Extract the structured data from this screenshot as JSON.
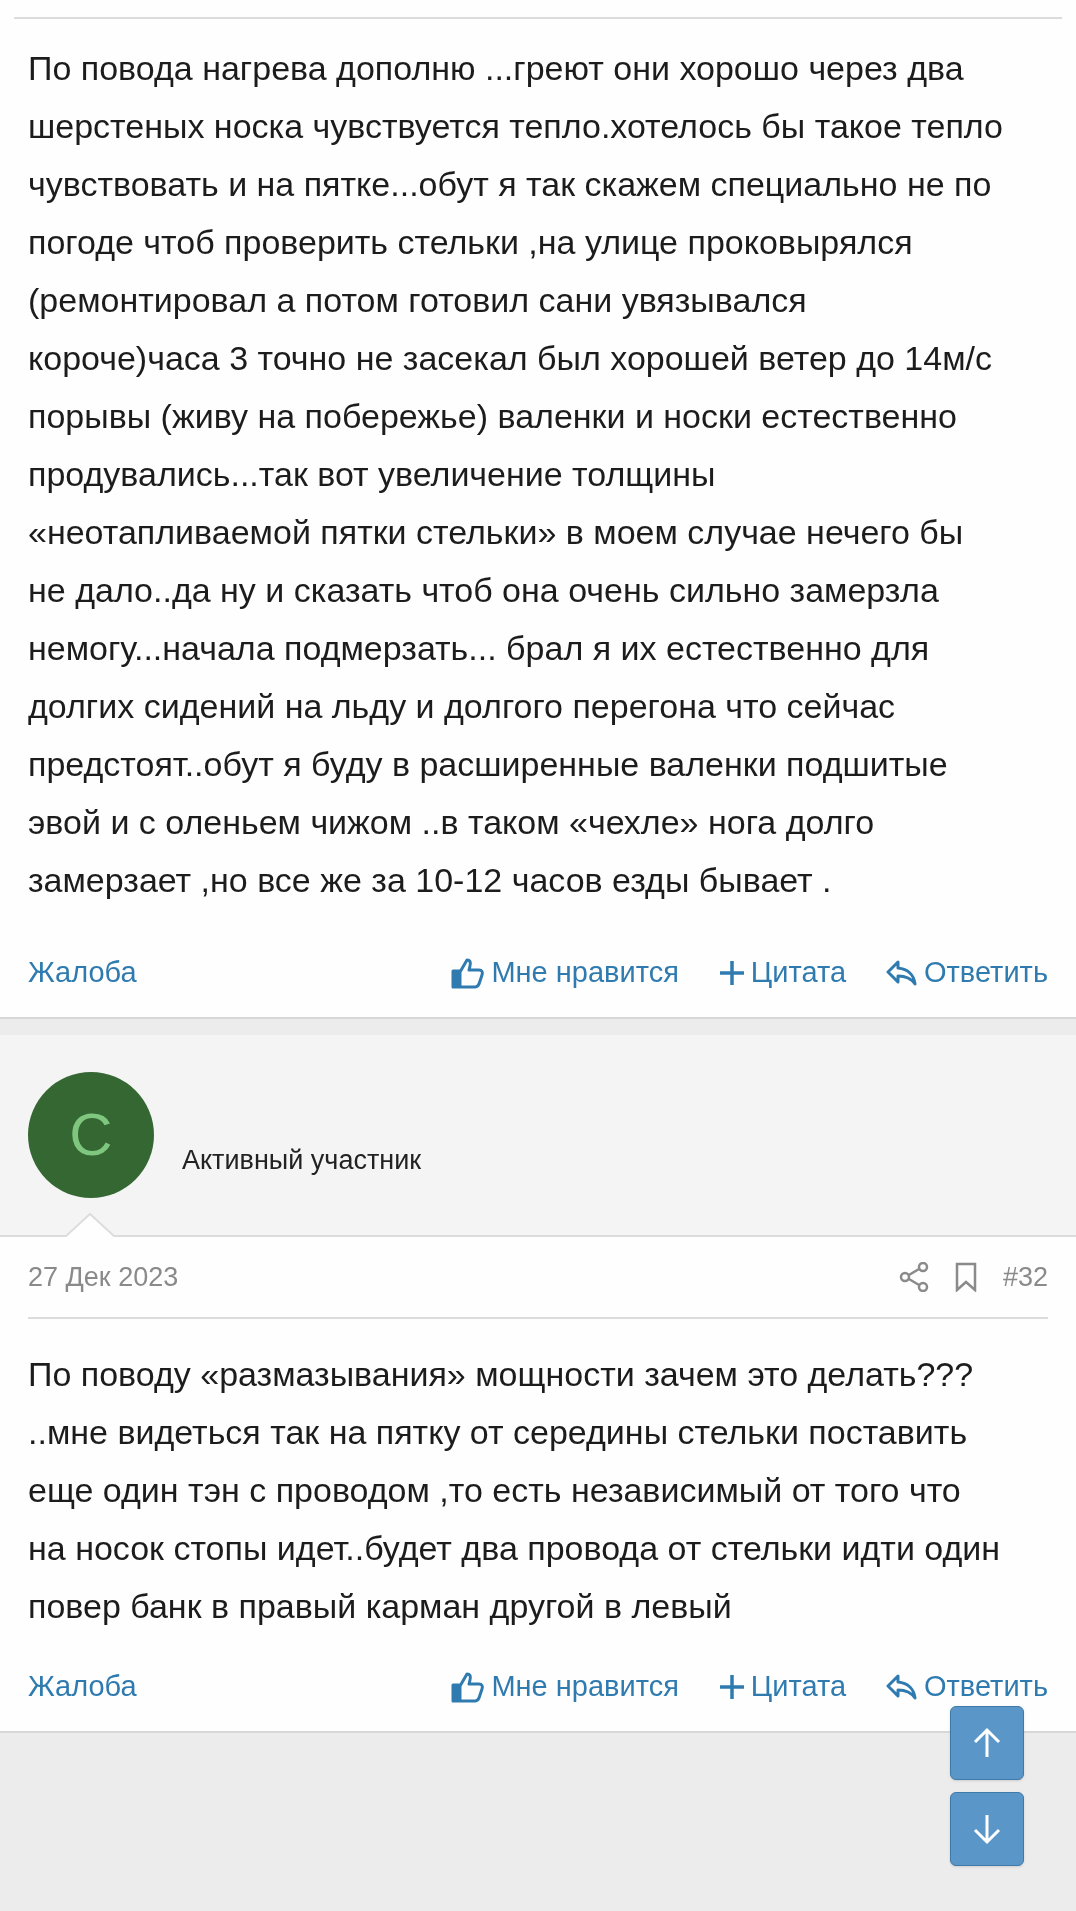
{
  "posts": [
    {
      "body": "По повода нагрева дополню ...греют они хорошо через два шерстеных носка чувствуется тепло.хотелось бы такое тепло чувствовать и на пятке...обут я так скажем специально не по погоде чтоб проверить стельки ,на улице проковырялся (ремонтировал а потом готовил сани увязывался короче)часа 3 точно не засекал был хорошей ветер до 14м/с порывы (живу на побережье) валенки и носки естественно продувались...так вот увеличение толщины «неотапливаемой пятки стельки» в моем случае нечего бы не дало..да ну и сказать чтоб она очень сильно замерзла немогу...начала подмерзать... брал я их естественно для долгих сидений на льду и долгого перегона что сейчас предстоят..обут я буду в расширенные валенки подшитые эвой и с оленьем чижом ..в таком «чехле» нога долго замерзает ,но все же за 10-12 часов езды бывает .",
      "actions": [
        {
          "label": "Жалоба",
          "kind": "report"
        },
        {
          "label": "Мне нравится",
          "kind": "like"
        },
        {
          "label": "Цитата",
          "kind": "quote"
        },
        {
          "label": "Ответить",
          "kind": "reply"
        }
      ]
    },
    {
      "author": {
        "avatar_letter": "С",
        "role": "Активный участник"
      },
      "date": "27 Дек 2023",
      "number": "#32",
      "body": "По поводу «размазывания» мощности зачем это делать??? ..мне видеться так на пятку от середины стельки поставить еще один тэн с проводом ,то есть независимый от того что на носок стопы идет..будет два провода от стельки идти один повер банк в правый карман другой в левый",
      "actions": [
        {
          "label": "Жалоба",
          "kind": "report"
        },
        {
          "label": "Мне нравится",
          "kind": "like"
        },
        {
          "label": "Цитата",
          "kind": "quote"
        },
        {
          "label": "Ответить",
          "kind": "reply"
        }
      ]
    }
  ]
}
